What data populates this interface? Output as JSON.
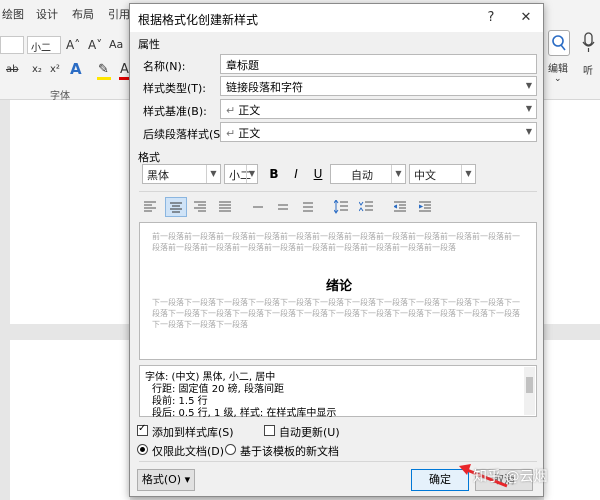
{
  "word_bg": {
    "tabs": [
      "绘图",
      "设计",
      "布局",
      "引用"
    ],
    "font_size": "小二",
    "group_font_label": "字体",
    "edit_label": "编辑",
    "side_label": "听"
  },
  "dialog": {
    "title": "根据格式化创建新样式",
    "help_label": "?",
    "close_label": "✕",
    "properties_section": "属性",
    "name_label": "名称(N):",
    "name_value": "章标题",
    "type_label": "样式类型(T):",
    "type_value": "链接段落和字符",
    "base_label": "样式基准(B):",
    "base_value": "正文",
    "next_label": "后续段落样式(S):",
    "next_value": "正文",
    "format_section": "格式",
    "font": "黑体",
    "size": "小二",
    "bold": "B",
    "italic": "I",
    "underline": "U",
    "color": "自动",
    "script": "中文",
    "preview": {
      "before": "前一段落前一段落前一段落前一段落前一段落前一段落前一段落前一段落前一段落前一段落前一段落前一段落前一段落前一段落前一段落前一段落前一段落前一段落前一段落前一段落前一段落",
      "heading": "绪论",
      "after": "下一段落下一段落下一段落下一段落下一段落下一段落下一段落下一段落下一段落下一段落下一段落下一段落下一段落下一段落下一段落下一段落下一段落下一段落下一段落下一段落下一段落下一段落下一段落下一段落下一段落下一段落"
    },
    "description": [
      "字体: (中文) 黑体, 小二, 居中",
      "行距: 固定值 20 磅, 段落间距",
      "段前: 1.5 行",
      "段后: 0.5 行, 1 级, 样式: 在样式库中显示"
    ],
    "add_to_gallery_label": "添加到样式库(S)",
    "add_to_gallery_checked": true,
    "auto_update_label": "自动更新(U)",
    "auto_update_checked": false,
    "this_doc_label": "仅限此文档(D)",
    "template_label": "基于该模板的新文档",
    "format_button": "格式(O) ▾",
    "ok_button": "确定",
    "cancel_partial": "取消"
  },
  "watermark": "知乎 @云烟"
}
